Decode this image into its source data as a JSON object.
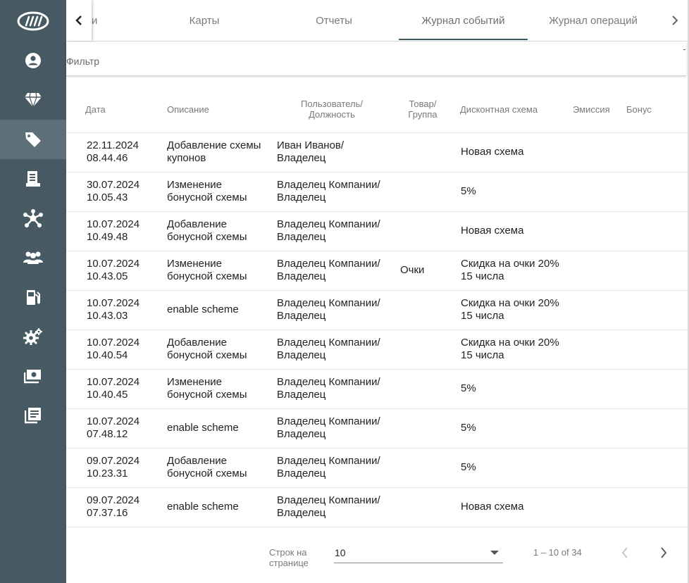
{
  "sidebar": {
    "items": [
      {
        "icon": "logo-icon"
      },
      {
        "icon": "account-icon"
      },
      {
        "icon": "diamond-icon"
      },
      {
        "icon": "tag-icon",
        "active": true
      },
      {
        "icon": "receipt-icon"
      },
      {
        "icon": "network-icon"
      },
      {
        "icon": "people-icon"
      },
      {
        "icon": "gas-station-icon"
      },
      {
        "icon": "settings-icon"
      },
      {
        "icon": "money-icon"
      },
      {
        "icon": "list-icon"
      }
    ]
  },
  "tabs": {
    "items": [
      "и",
      "Карты",
      "Отчеты",
      "Журнал событий",
      "Журнал операций"
    ],
    "active": "Журнал событий"
  },
  "filter": {
    "label": "Фильтр"
  },
  "table": {
    "headers": {
      "date": "Дата",
      "description": "Описание",
      "user_line1": "Пользователь/",
      "user_line2": "Должность",
      "product_line1": "Товар/",
      "product_line2": "Группа",
      "scheme": "Дисконтная схема",
      "emission": "Эмиссия",
      "bonus": "Бонус"
    },
    "rows": [
      {
        "date": "22.11.2024",
        "time": "08.44.46",
        "desc1": "Добавление схемы",
        "desc2": "купонов",
        "user1": "Иван Иванов/",
        "user2": "Владелец",
        "product": "",
        "scheme1": "Новая схема",
        "scheme2": ""
      },
      {
        "date": "30.07.2024",
        "time": "10.05.43",
        "desc1": "Изменение",
        "desc2": "бонусной схемы",
        "user1": "Владелец Компании/",
        "user2": "Владелец",
        "product": "",
        "scheme1": "5%",
        "scheme2": ""
      },
      {
        "date": "10.07.2024",
        "time": "10.49.48",
        "desc1": "Добавление",
        "desc2": "бонусной схемы",
        "user1": "Владелец Компании/",
        "user2": "Владелец",
        "product": "",
        "scheme1": "Новая схема",
        "scheme2": ""
      },
      {
        "date": "10.07.2024",
        "time": "10.43.05",
        "desc1": "Изменение",
        "desc2": "бонусной схемы",
        "user1": "Владелец Компании/",
        "user2": "Владелец",
        "product": "Очки",
        "scheme1": "Скидка на очки 20%",
        "scheme2": "15 числа"
      },
      {
        "date": "10.07.2024",
        "time": "10.43.03",
        "desc1": "enable scheme",
        "desc2": "",
        "user1": "Владелец Компании/",
        "user2": "Владелец",
        "product": "",
        "scheme1": "Скидка на очки 20%",
        "scheme2": "15 числа"
      },
      {
        "date": "10.07.2024",
        "time": "10.40.54",
        "desc1": "Добавление",
        "desc2": "бонусной схемы",
        "user1": "Владелец Компании/",
        "user2": "Владелец",
        "product": "",
        "scheme1": "Скидка на очки 20%",
        "scheme2": "15 числа"
      },
      {
        "date": "10.07.2024",
        "time": "10.40.45",
        "desc1": "Изменение",
        "desc2": "бонусной схемы",
        "user1": "Владелец Компании/",
        "user2": "Владелец",
        "product": "",
        "scheme1": "5%",
        "scheme2": ""
      },
      {
        "date": "10.07.2024",
        "time": "07.48.12",
        "desc1": "enable scheme",
        "desc2": "",
        "user1": "Владелец Компании/",
        "user2": "Владелец",
        "product": "",
        "scheme1": "5%",
        "scheme2": ""
      },
      {
        "date": "09.07.2024",
        "time": "10.23.31",
        "desc1": "Добавление",
        "desc2": "бонусной схемы",
        "user1": "Владелец Компании/",
        "user2": "Владелец",
        "product": "",
        "scheme1": "5%",
        "scheme2": ""
      },
      {
        "date": "09.07.2024",
        "time": "07.37.16",
        "desc1": "enable scheme",
        "desc2": "",
        "user1": "Владелец Компании/",
        "user2": "Владелец",
        "product": "",
        "scheme1": "Новая схема",
        "scheme2": ""
      }
    ]
  },
  "pagination": {
    "rows_label_line1": "Строк на",
    "rows_label_line2": "странице",
    "rows_per_page": "10",
    "range": "1 – 10 of 34"
  },
  "colors": {
    "sidebar_bg": "#475a63",
    "sidebar_active": "#5d6f78",
    "tab_ink": "#3f5964"
  }
}
